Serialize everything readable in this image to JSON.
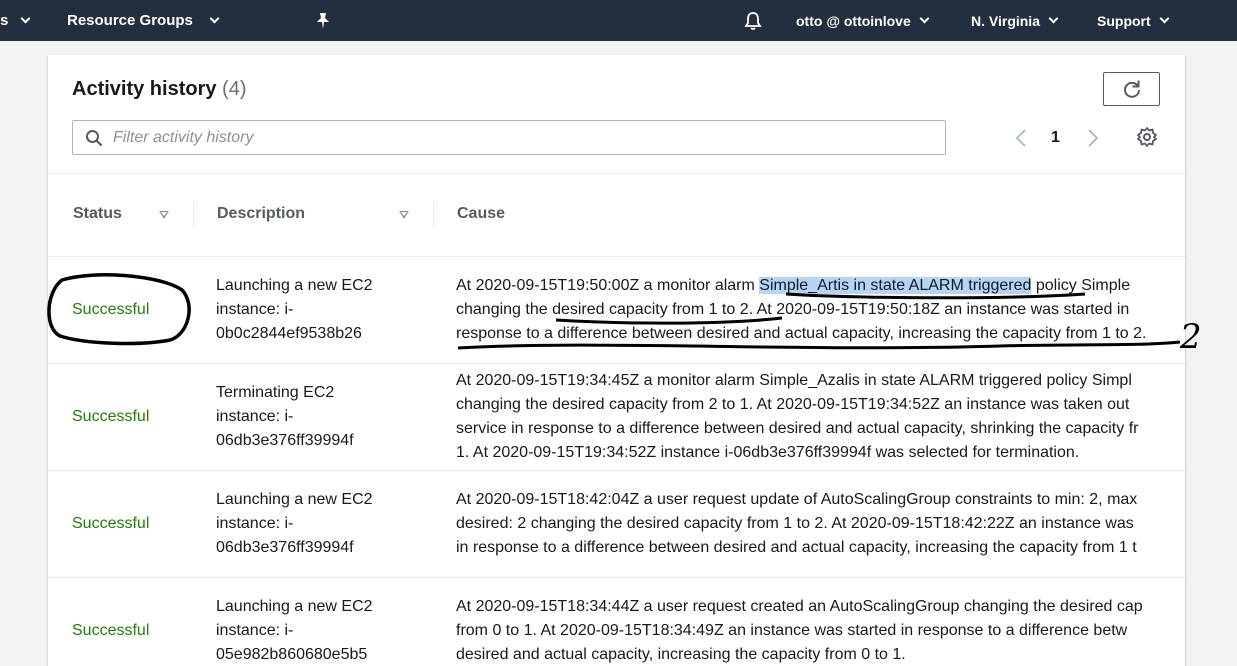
{
  "topnav": {
    "services_fragment": "s",
    "resource_groups": "Resource Groups",
    "user": "otto @ ottoinlove",
    "region": "N. Virginia",
    "support": "Support"
  },
  "panel": {
    "title": "Activity history",
    "count": "(4)",
    "filter_placeholder": "Filter activity history",
    "page": "1"
  },
  "table": {
    "headers": {
      "status": "Status",
      "description": "Description",
      "cause": "Cause"
    },
    "rows": [
      {
        "status": "Successful",
        "description": [
          "Launching a new EC2",
          "instance: i-",
          "0b0c2844ef9538b26"
        ],
        "cause": {
          "line1_pre": "At 2020-09-15T19:50:00Z a monitor alarm ",
          "line1_hl": "Simple_Artis in state ALARM triggered",
          "line1_post": " policy Simple",
          "line2": "changing the desired capacity from 1 to 2. At 2020-09-15T19:50:18Z an instance was started in",
          "line3": "response to a difference between desired and actual capacity, increasing the capacity from 1 to 2."
        }
      },
      {
        "status": "Successful",
        "description": [
          "Terminating EC2",
          "instance: i-",
          "06db3e376ff39994f"
        ],
        "cause": [
          "At 2020-09-15T19:34:45Z a monitor alarm Simple_Azalis in state ALARM triggered policy Simpl",
          "changing the desired capacity from 2 to 1. At 2020-09-15T19:34:52Z an instance was taken out",
          "service in response to a difference between desired and actual capacity, shrinking the capacity fr",
          "1. At 2020-09-15T19:34:52Z instance i-06db3e376ff39994f was selected for termination."
        ]
      },
      {
        "status": "Successful",
        "description": [
          "Launching a new EC2",
          "instance: i-",
          "06db3e376ff39994f"
        ],
        "cause": [
          "At 2020-09-15T18:42:04Z a user request update of AutoScalingGroup constraints to min: 2, max",
          "desired: 2 changing the desired capacity from 1 to 2. At 2020-09-15T18:42:22Z an instance was",
          "in response to a difference between desired and actual capacity, increasing the capacity from 1 t"
        ]
      },
      {
        "status": "Successful",
        "description": [
          "Launching a new EC2",
          "instance: i-",
          "05e982b860680e5b5"
        ],
        "cause": [
          "At 2020-09-15T18:34:44Z a user request created an AutoScalingGroup changing the desired cap",
          "from 0 to 1. At 2020-09-15T18:34:49Z an instance was started in response to a difference betw",
          "desired and actual capacity, increasing the capacity from 0 to 1."
        ]
      }
    ]
  },
  "annotation": {
    "handwritten_number": "2"
  },
  "colors": {
    "nav_bg": "#232f3e",
    "success": "#1d8102",
    "highlight": "#b6d4f5"
  }
}
